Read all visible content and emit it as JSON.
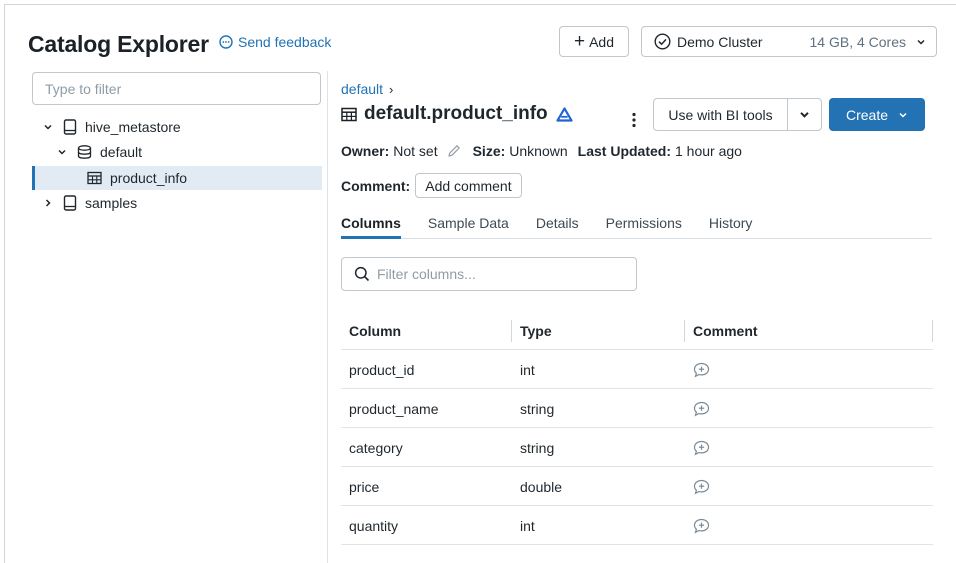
{
  "header": {
    "title": "Catalog Explorer",
    "feedback_label": "Send feedback",
    "add_label": "Add",
    "cluster_name": "Demo Cluster",
    "cluster_spec": "14 GB, 4 Cores"
  },
  "sidebar": {
    "filter_placeholder": "Type to filter",
    "tree": [
      {
        "label": "hive_metastore",
        "expanded": true,
        "icon": "catalog-icon"
      },
      {
        "label": "default",
        "expanded": true,
        "icon": "database-icon"
      },
      {
        "label": "product_info",
        "selected": true,
        "icon": "table-icon"
      },
      {
        "label": "samples",
        "expanded": false,
        "icon": "catalog-icon"
      }
    ]
  },
  "main": {
    "breadcrumb": "default",
    "table_name": "default.product_info",
    "more_icon": "kebab-icon",
    "bi_label": "Use with BI tools",
    "create_label": "Create",
    "owner_label": "Owner:",
    "owner_value": "Not set",
    "size_label": "Size:",
    "size_value": "Unknown",
    "updated_label": "Last Updated:",
    "updated_value": "1 hour ago",
    "comment_label": "Comment:",
    "add_comment_label": "Add comment",
    "tabs": [
      "Columns",
      "Sample Data",
      "Details",
      "Permissions",
      "History"
    ],
    "active_tab": "Columns",
    "column_filter_placeholder": "Filter columns...",
    "columns_header": [
      "Column",
      "Type",
      "Comment"
    ],
    "rows": [
      {
        "column": "product_id",
        "type": "int"
      },
      {
        "column": "product_name",
        "type": "string"
      },
      {
        "column": "category",
        "type": "string"
      },
      {
        "column": "price",
        "type": "double"
      },
      {
        "column": "quantity",
        "type": "int"
      }
    ]
  },
  "colors": {
    "accent": "#2272b4",
    "selected_bg": "#e2ebf4",
    "border": "#c0c7cd",
    "delta": "#1e63d6"
  }
}
